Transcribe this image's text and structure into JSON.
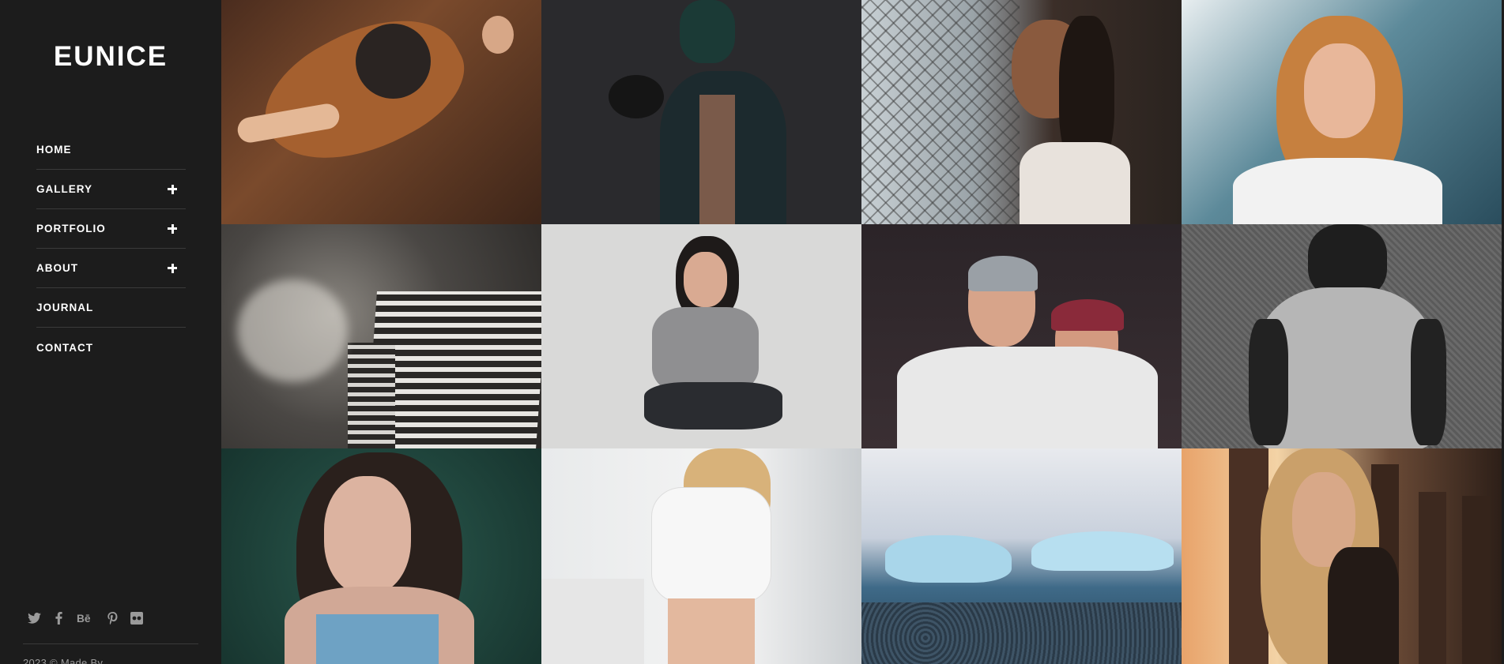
{
  "sidebar": {
    "logo": "EUNICE",
    "nav": [
      {
        "label": "HOME",
        "has_submenu": false
      },
      {
        "label": "GALLERY",
        "has_submenu": true
      },
      {
        "label": "PORTFOLIO",
        "has_submenu": true
      },
      {
        "label": "ABOUT",
        "has_submenu": true
      },
      {
        "label": "JOURNAL",
        "has_submenu": false
      },
      {
        "label": "CONTACT",
        "has_submenu": false
      }
    ],
    "social": [
      "twitter-icon",
      "facebook-icon",
      "behance-icon",
      "pinterest-icon",
      "flickr-icon"
    ],
    "copyright": "2023 © Made By"
  },
  "gallery": {
    "tiles": [
      "woman-lying-on-floor-with-hat",
      "boxer-in-dark",
      "woman-by-chain-fence",
      "redhead-woman-backlit",
      "skyscraper-clouds-bw",
      "woman-kneeling-on-pavement",
      "two-men-funny-faces",
      "person-grey-hoodie-back",
      "woman-lying-in-leaves",
      "blonde-woman-white-top",
      "icebergs-on-beach",
      "woman-with-sunglasses-sunset"
    ]
  },
  "colors": {
    "sidebar_bg": "#1c1c1c",
    "nav_text": "#ffffff",
    "divider": "#3a3a3a",
    "muted": "#9a9a9a"
  }
}
